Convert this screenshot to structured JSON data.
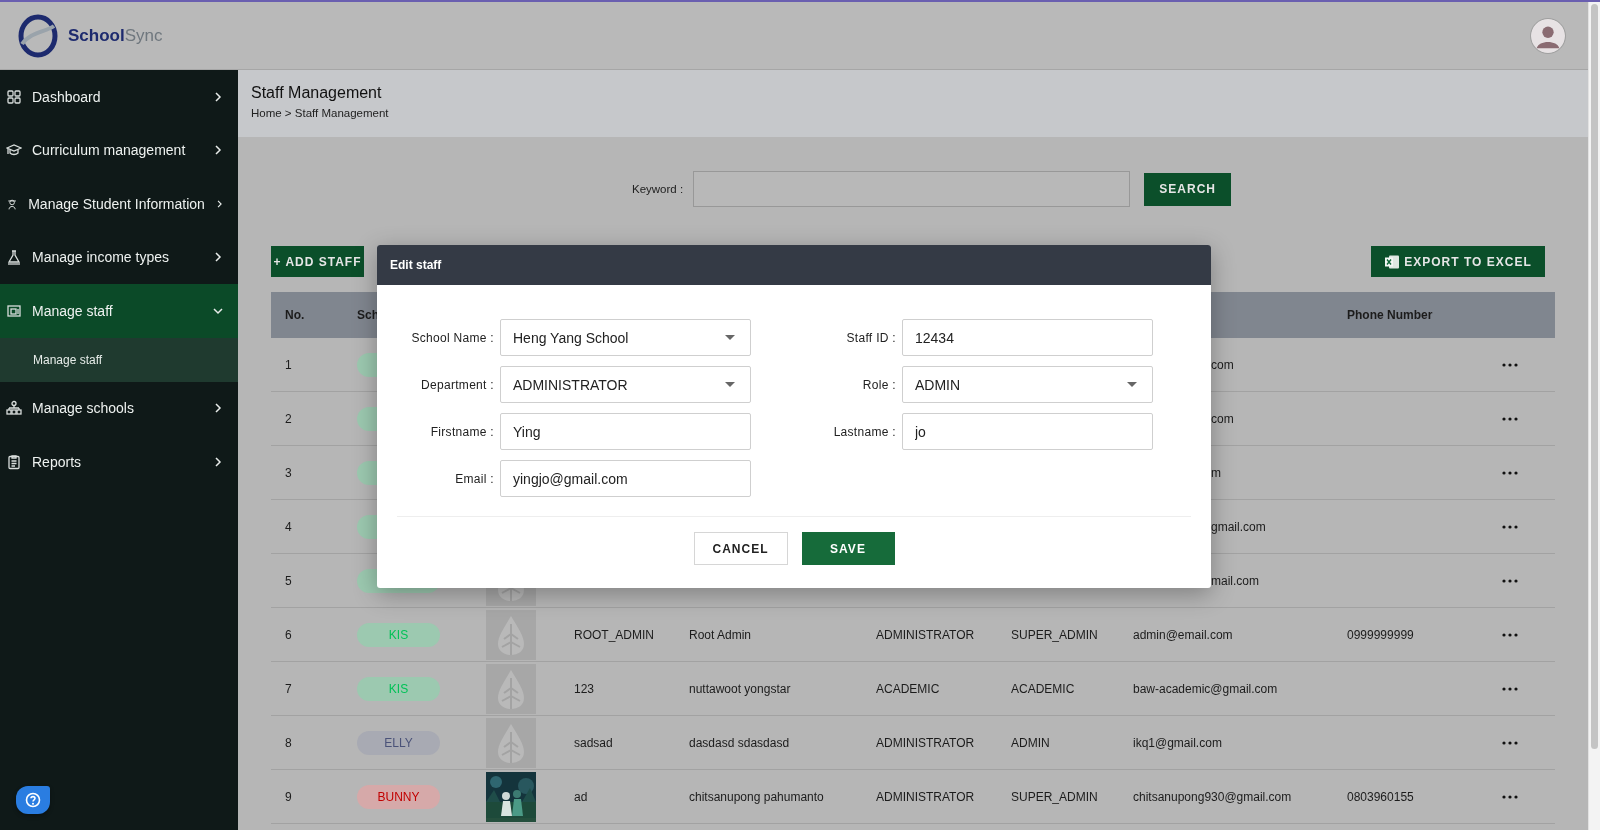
{
  "header": {
    "logo": {
      "part_1": "School",
      "part_2": "Sync"
    }
  },
  "sidebar": {
    "items": [
      {
        "label": "Dashboard",
        "selected": false,
        "expanded": false
      },
      {
        "label": "Curriculum management",
        "selected": false,
        "expanded": false
      },
      {
        "label": "Manage Student Information",
        "selected": false,
        "expanded": false
      },
      {
        "label": "Manage income types",
        "selected": false,
        "expanded": false
      },
      {
        "label": "Manage staff",
        "selected": true,
        "expanded": true,
        "children": [
          {
            "label": "Manage staff",
            "selected": true
          }
        ]
      },
      {
        "label": "Manage schools",
        "selected": false,
        "expanded": false
      },
      {
        "label": "Reports",
        "selected": false,
        "expanded": false
      }
    ]
  },
  "page": {
    "title": "Staff Management",
    "breadcrumb": "Home > Staff Management"
  },
  "search": {
    "label": "Keyword :",
    "button": "SEARCH"
  },
  "actions": {
    "add": "+ ADD STAFF",
    "export": "EXPORT TO EXCEL"
  },
  "table": {
    "header": {
      "column_1": "No.",
      "column_2": "Sch",
      "column_9": "Phone Number"
    },
    "rows": [
      {
        "covered": true,
        "column_1": "1",
        "column_2": {
          "color": "#9cc9b0"
        },
        "column_8": "com"
      },
      {
        "covered": true,
        "column_1": "2",
        "column_2": {
          "color": "#9cc9b0"
        },
        "column_8": "com"
      },
      {
        "covered": true,
        "column_1": "3",
        "column_2": {
          "color": "#9cc9b0"
        },
        "column_8": "m"
      },
      {
        "covered": true,
        "column_1": "4",
        "column_2": {
          "color": "#9cc9b0"
        },
        "column_8": "gmail.com"
      },
      {
        "covered": true,
        "column_1": "5",
        "column_2": {
          "color": "#9cc9b0"
        },
        "column_3": {
          "kind": "placeholder"
        },
        "column_8": "mail.com"
      },
      {
        "covered": false,
        "column_1": "6",
        "column_2": {
          "label": "KIS",
          "color": "#9cc9b0"
        },
        "column_3": {
          "kind": "placeholder"
        },
        "column_4": "ROOT_ADMIN",
        "column_5": "Root Admin",
        "column_6": "ADMINISTRATOR",
        "column_7": "SUPER_ADMIN",
        "column_8": "admin@email.com",
        "column_9": "0999999999"
      },
      {
        "covered": false,
        "column_1": "7",
        "column_2": {
          "label": "KIS",
          "color": "#9cc9b0"
        },
        "column_3": {
          "kind": "placeholder"
        },
        "column_4": "123",
        "column_5": "nuttawoot yongstar",
        "column_6": "ACADEMIC",
        "column_7": "ACADEMIC",
        "column_8": "baw-academic@gmail.com"
      },
      {
        "covered": false,
        "column_1": "8",
        "column_2": {
          "label": "ELLY",
          "color": "#a8aab3"
        },
        "column_3": {
          "kind": "placeholder"
        },
        "column_4": "sadsad",
        "column_5": "dasdasd sdasdasd",
        "column_6": "ADMINISTRATOR",
        "column_7": "ADMIN",
        "column_8": "ikq1@gmail.com"
      },
      {
        "covered": false,
        "column_1": "9",
        "column_2": {
          "label": "BUNNY",
          "color": "#d6a9a9"
        },
        "column_4": "ad",
        "column_5": "chitsanupong pahumanto",
        "column_6": "ADMINISTRATOR",
        "column_7": "SUPER_ADMIN",
        "column_8": "chitsanupong930@gmail.com",
        "column_9": "0803960155"
      }
    ]
  },
  "modal": {
    "title": "Edit staff",
    "fields": [
      {
        "label": "School Name :",
        "value": "Heng Yang School",
        "kind": "select"
      },
      {
        "label": "Staff ID :",
        "value": "12434",
        "kind": "input"
      },
      {
        "label": "Department :",
        "value": "ADMINISTRATOR",
        "kind": "select"
      },
      {
        "label": "Role :",
        "value": "ADMIN",
        "kind": "select"
      },
      {
        "label": "Firstname :",
        "value": "Ying",
        "kind": "input"
      },
      {
        "label": "Lastname :",
        "value": "jo",
        "kind": "input"
      },
      {
        "label": "Email :",
        "value": "yingjo@gmail.com",
        "kind": "input"
      }
    ],
    "buttons": {
      "cancel": "CANCEL",
      "save": "SAVE"
    }
  }
}
